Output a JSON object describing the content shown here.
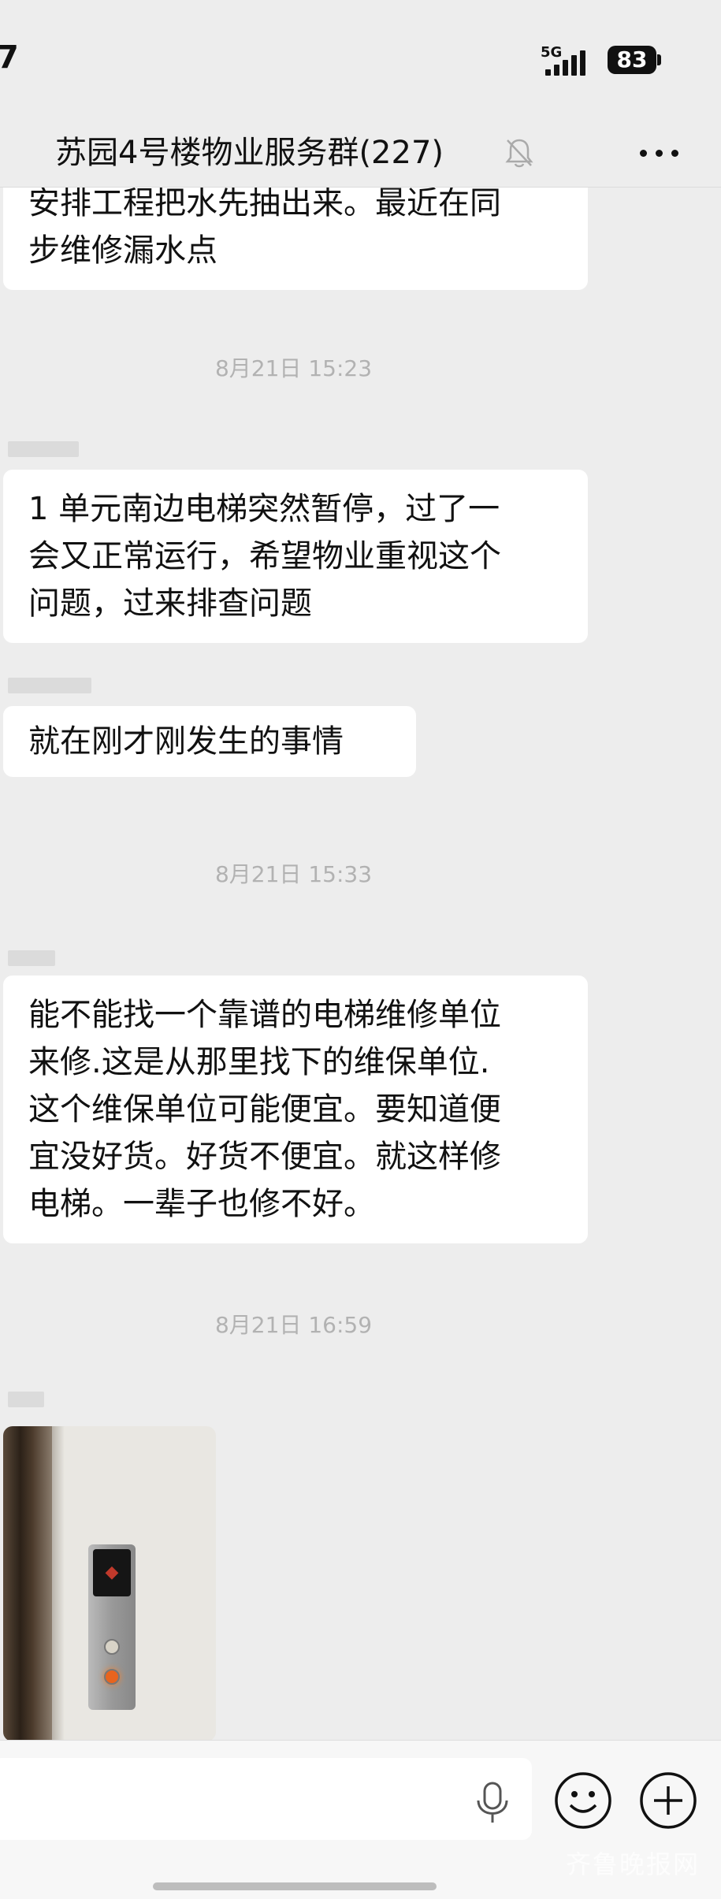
{
  "status_bar": {
    "time": "7",
    "network": "5G",
    "battery": "83"
  },
  "header": {
    "title": "苏园4号楼物业服务群(227)",
    "bell_icon": "bell-muted-icon",
    "more_icon": "more-dots-icon"
  },
  "messages": {
    "msg1": {
      "line1": "安排工程把水先抽出来。最近在同",
      "line2": "步维修漏水点"
    },
    "timestamp1": "8月21日 15:23",
    "msg2": {
      "line1": "1 单元南边电梯突然暂停，过了一",
      "line2": "会又正常运行，希望物业重视这个",
      "line3": "问题，过来排查问题"
    },
    "msg3": {
      "line1": "就在刚才刚发生的事情"
    },
    "timestamp2": "8月21日 15:33",
    "msg4": {
      "line1": "能不能找一个靠谱的电梯维修单位",
      "line2": "来修.这是从那里找下的维保单位.",
      "line3": "这个维保单位可能便宜。要知道便",
      "line4": "宜没好货。好货不便宜。就这样修",
      "line5": "电梯。一辈子也修不好。"
    },
    "timestamp3": "8月21日 16:59"
  },
  "input_bar": {
    "mic_icon": "microphone-icon",
    "emoji_icon": "emoji-icon",
    "plus_icon": "plus-icon"
  },
  "watermark": "齐鲁晚报网"
}
